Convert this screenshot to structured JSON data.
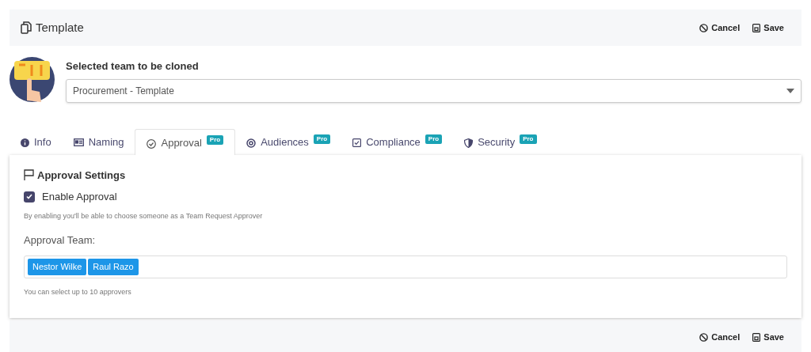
{
  "header": {
    "title": "Template",
    "actions": [
      "Cancel",
      "Save"
    ]
  },
  "team_picker": {
    "label": "Selected team to be cloned",
    "value": "Procurement - Template"
  },
  "tabs": [
    {
      "label": "Info",
      "selected": false
    },
    {
      "label": "Naming",
      "selected": false
    },
    {
      "label": "Approval",
      "selected": true,
      "badge": "Pro"
    },
    {
      "label": "Audiences",
      "selected": false,
      "badge": "Pro"
    },
    {
      "label": "Compliance",
      "selected": false,
      "badge": "Pro"
    },
    {
      "label": "Security",
      "selected": false,
      "badge": "Pro"
    }
  ],
  "panel": {
    "title": "Approval Settings",
    "enable": {
      "label": "Enable Approval",
      "checked": true
    },
    "hint": "By enabling you'll be able to choose someone as a Team Request Approver",
    "team_label": "Approval Team:",
    "approvers": [
      "Nestor Wilke",
      "Raul Razo"
    ],
    "limit_note": "You can select up to 10 approvers"
  },
  "footer": {
    "actions": [
      "Cancel",
      "Save"
    ]
  }
}
